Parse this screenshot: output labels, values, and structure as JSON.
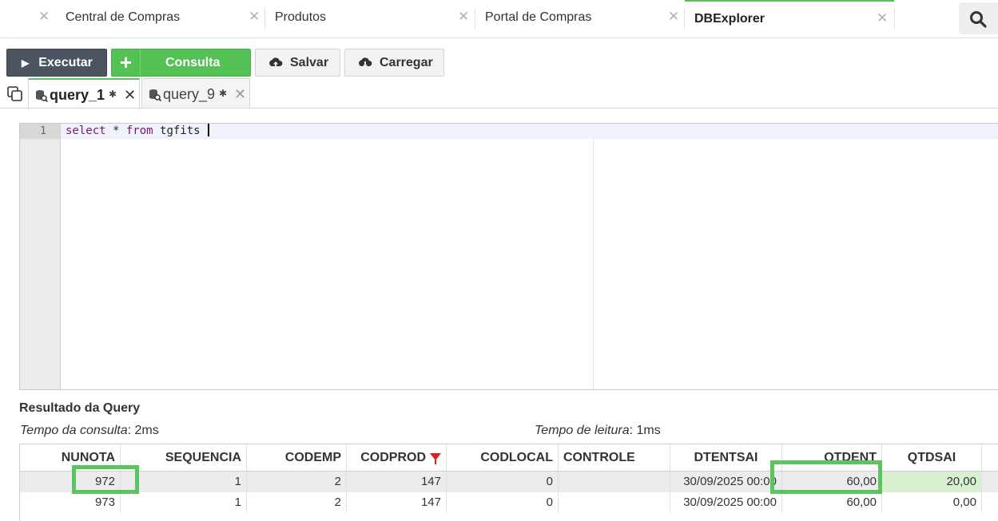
{
  "app_tabs": [
    {
      "label": "Central de Compras",
      "active": false
    },
    {
      "label": "Produtos",
      "active": false
    },
    {
      "label": "Portal de Compras",
      "active": false
    },
    {
      "label": "DBExplorer",
      "active": true
    }
  ],
  "toolbar": {
    "execute_label": "Executar",
    "query_label": "Consulta",
    "save_label": "Salvar",
    "load_label": "Carregar"
  },
  "query_tabs": [
    {
      "label": "query_1",
      "active": true
    },
    {
      "label": "query_9",
      "active": false
    }
  ],
  "editor": {
    "line_number": "1",
    "code_keyword_1": "select",
    "code_mid": " * ",
    "code_keyword_2": "from",
    "code_table": " tgfits "
  },
  "results": {
    "title": "Resultado da Query",
    "query_time_label": "Tempo da consulta",
    "query_time_value": ": 2ms",
    "read_time_label": "Tempo de leitura",
    "read_time_value": ": 1ms",
    "columns": [
      "NUNOTA",
      "SEQUENCIA",
      "CODEMP",
      "CODPROD",
      "CODLOCAL",
      "CONTROLE",
      "DTENTSAI",
      "QTDENT",
      "QTDSAI"
    ],
    "filtered_column": "CODPROD",
    "rows": [
      {
        "NUNOTA": "972",
        "SEQUENCIA": "1",
        "CODEMP": "2",
        "CODPROD": "147",
        "CODLOCAL": "0",
        "CONTROLE": "",
        "DTENTSAI": "30/09/2025 00:00",
        "QTDENT": "60,00",
        "QTDSAI": "20,00",
        "selected": true
      },
      {
        "NUNOTA": "973",
        "SEQUENCIA": "1",
        "CODEMP": "2",
        "CODPROD": "147",
        "CODLOCAL": "0",
        "CONTROLE": "",
        "DTENTSAI": "30/09/2025 00:00",
        "QTDENT": "60,00",
        "QTDSAI": "0,00",
        "selected": false
      }
    ]
  },
  "colors": {
    "accent_green": "#5cbf60",
    "highlight_green": "#5cc45e",
    "execute_button": "#4a5561",
    "filter_red": "#e02020"
  }
}
